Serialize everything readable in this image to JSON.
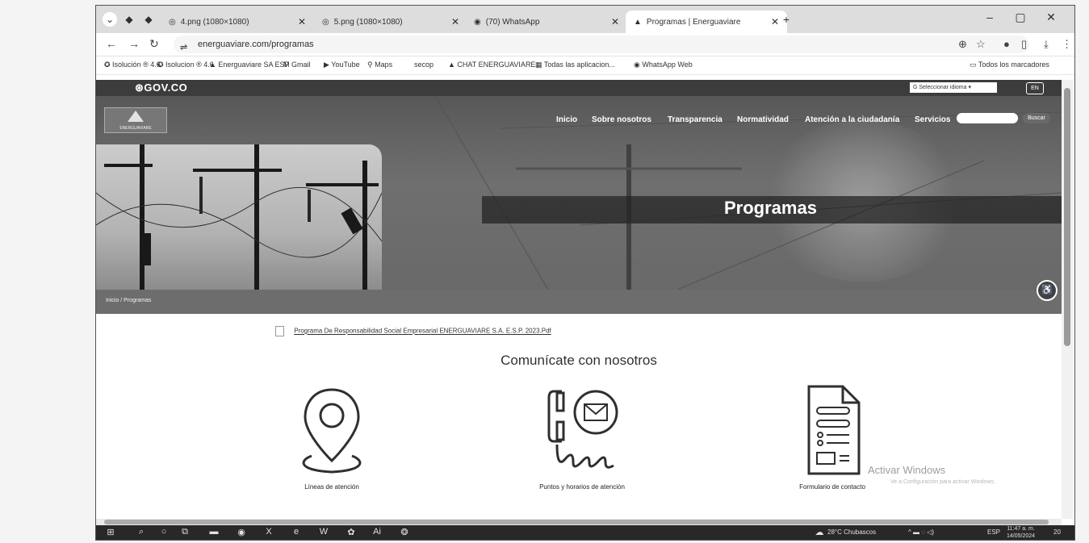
{
  "browser": {
    "tabs": [
      {
        "label": "4.png (1080×1080)",
        "active": false
      },
      {
        "label": "5.png (1080×1080)",
        "active": false
      },
      {
        "label": "(70) WhatsApp",
        "active": false
      },
      {
        "label": "Programas | Energuaviare",
        "active": true
      }
    ],
    "new_tab": "+",
    "url": "energuaviare.com/programas",
    "bookmarks": [
      "Isolución ® 4.6",
      "Isolucion ® 4.6",
      "Energuaviare SA ESP",
      "Gmail",
      "YouTube",
      "Maps",
      "secop",
      "CHAT ENERGUAVIARE",
      "Todas las aplicacion...",
      "WhatsApp Web"
    ],
    "all_bookmarks": "Todos los marcadores"
  },
  "site": {
    "gov_logo": "GOV.CO",
    "language_select": "Seleccionar idioma",
    "lang_toggle": "EN",
    "logo_text": "ENERGUAVIARE",
    "nav": [
      "Inicio",
      "Sobre nosotros",
      "Transparencia",
      "Normatividad",
      "Atención a la ciudadanía",
      "Servicios"
    ],
    "search_button": "Buscar",
    "page_title": "Programas",
    "breadcrumb": "Inicio / Programas",
    "pdf_link": "Programa De Responsabilidad Social Empresarial ENERGUAVIARE S.A. E.S.P. 2023.Pdf",
    "contact_heading": "Comunícate con nosotros",
    "contact_items": [
      {
        "label": "Líneas de atención",
        "icon": "location-pin-icon"
      },
      {
        "label": "Puntos y horarios de atención",
        "icon": "phone-message-icon"
      },
      {
        "label": "Formulario de contacto",
        "icon": "form-document-icon"
      }
    ]
  },
  "os": {
    "activate_windows": "Activar Windows",
    "activate_hint": "Ve a Configuración para activar Windows.",
    "weather": "28°C Chubascos",
    "lang": "ESP",
    "time": "11:47 a. m.",
    "date": "14/05/2024",
    "notifications": "20"
  }
}
